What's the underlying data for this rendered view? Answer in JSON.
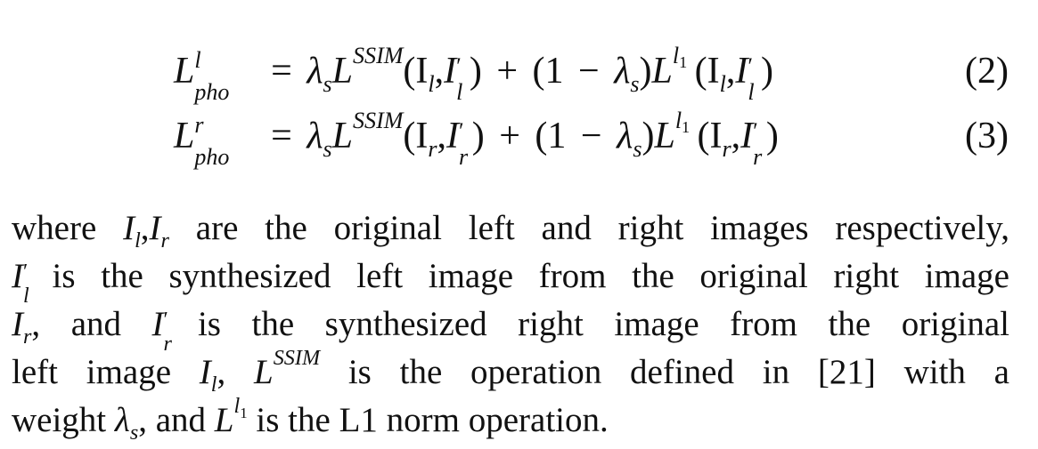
{
  "equations": [
    {
      "lhs_symbol": "L",
      "lhs_sup": "l",
      "lhs_sub": "pho",
      "eq_sign": "=",
      "lambda": "λ",
      "lambda_sub": "s",
      "L1": "L",
      "L1_sup": "SSIM",
      "args1": "(I",
      "args1_sub": "l",
      "comma": ",",
      "arg2": "I",
      "arg2_prime": "′",
      "arg2_sub": "l",
      "close1": ")",
      "plus": "+",
      "paren_open": "(1",
      "minus": "−",
      "lambda2": "λ",
      "lambda2_sub": "s",
      "paren_close": ")",
      "L2": "L",
      "L2_sup": "l",
      "L2_sup_sub": "1",
      "args2_open": "(I",
      "args2_sub": "l",
      "args2_comma": ",",
      "args2_I": "I",
      "args2_prime": "′",
      "args2_I_sub": "l",
      "args2_close": ")",
      "number": "(2)"
    },
    {
      "lhs_symbol": "L",
      "lhs_sup": "r",
      "lhs_sub": "pho",
      "eq_sign": "=",
      "lambda": "λ",
      "lambda_sub": "s",
      "L1": "L",
      "L1_sup": "SSIM",
      "args1": "(I",
      "args1_sub": "r",
      "comma": ",",
      "arg2": "I",
      "arg2_prime": "′",
      "arg2_sub": "r",
      "close1": ")",
      "plus": "+",
      "paren_open": "(1",
      "minus": "−",
      "lambda2": "λ",
      "lambda2_sub": "s",
      "paren_close": ")",
      "L2": "L",
      "L2_sup": "l",
      "L2_sup_sub": "1",
      "args2_open": "(I",
      "args2_sub": "r",
      "args2_comma": ",",
      "args2_I": "I",
      "args2_prime": "′",
      "args2_I_sub": "r",
      "args2_close": ")",
      "number": "(3)"
    }
  ],
  "paragraph": {
    "line1": {
      "t1": "where ",
      "I": "I",
      "I_sub": "l",
      "comma": ",",
      "I2": "I",
      "I2_sub": "r",
      "t2": " are the original left and right images respectively,"
    },
    "line2": {
      "I": "I",
      "I_prime": "′",
      "I_sub": "l",
      "t1": " is the synthesized left image from the original right image"
    },
    "line3": {
      "I": "I",
      "I_sub": "r",
      "t1": ", and ",
      "I2": "I",
      "I2_prime": "′",
      "I2_sub": "r",
      "t2": " is the synthesized right image from the original"
    },
    "line4": {
      "t1": "left image ",
      "I": "I",
      "I_sub": "l",
      "t2": ", ",
      "L": "L",
      "L_sup": "SSIM",
      "t3": " is the operation defined in [21] with a"
    },
    "line5": {
      "t1": "weight ",
      "lambda": "λ",
      "lambda_sub": "s",
      "t2": ", and ",
      "L": "L",
      "L_sup": "l",
      "L_sup_sub": "1",
      "t3": " is the L1 norm operation."
    }
  }
}
